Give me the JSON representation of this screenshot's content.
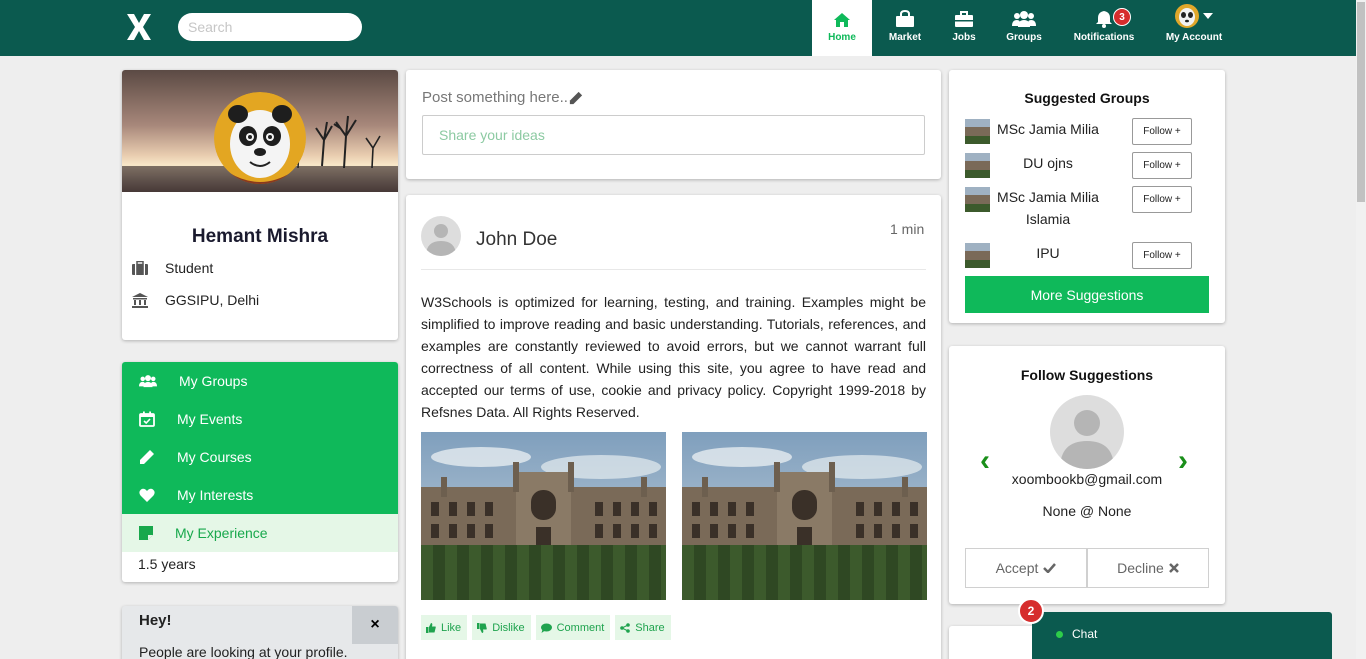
{
  "header": {
    "search_placeholder": "Search",
    "nav": [
      {
        "label": "Home",
        "icon": "home-icon"
      },
      {
        "label": "Market",
        "icon": "shopping-bag-icon"
      },
      {
        "label": "Jobs",
        "icon": "briefcase-icon"
      },
      {
        "label": "Groups",
        "icon": "users-icon"
      },
      {
        "label": "Notifications",
        "icon": "bell-icon",
        "badge": "3"
      },
      {
        "label": "My Account",
        "icon": "avatar-icon"
      }
    ]
  },
  "profile": {
    "name": "Hemant Mishra",
    "role": "Student",
    "institution": "GGSIPU, Delhi"
  },
  "menu": {
    "items": [
      "My Groups",
      "My Events",
      "My Courses",
      "My Interests",
      "My Experience"
    ],
    "experience_value": "1.5 years"
  },
  "hey": {
    "title": "Hey!",
    "close": "×",
    "text": "People are looking at your profile."
  },
  "composer": {
    "hint": "Post something here..",
    "placeholder": "Share your ideas"
  },
  "post": {
    "author": "John Doe",
    "time": "1 min",
    "text": "W3Schools is optimized for learning, testing, and training. Examples might be simplified to improve reading and basic understanding. Tutorials, references, and examples are constantly reviewed to avoid errors, but we cannot warrant full correctness of all content. While using this site, you agree to have read and accepted our terms of use, cookie and privacy policy. Copyright 1999-2018 by Refsnes Data. All Rights Reserved.",
    "actions": [
      "Like",
      "Dislike",
      "Comment",
      "Share"
    ]
  },
  "groups": {
    "title": "Suggested Groups",
    "items": [
      {
        "name": "MSc Jamia Milia",
        "follow": "Follow +"
      },
      {
        "name": "DU ojns",
        "follow": "Follow +"
      },
      {
        "name": "MSc Jamia Milia Islamia",
        "follow": "Follow +"
      },
      {
        "name": "IPU",
        "follow": "Follow +"
      }
    ],
    "more": "More Suggestions"
  },
  "follow": {
    "title": "Follow Suggestions",
    "email": "xoombookb@gmail.com",
    "org": "None @ None",
    "accept": "Accept",
    "decline": "Decline",
    "prev": "‹",
    "next": "›"
  },
  "chat": {
    "label": "Chat",
    "badge": "2"
  },
  "colors": {
    "topbar": "#0b5a4f",
    "accent": "#0fb95a",
    "light_accent": "#e5f7e7",
    "badge": "#d62d2d"
  }
}
